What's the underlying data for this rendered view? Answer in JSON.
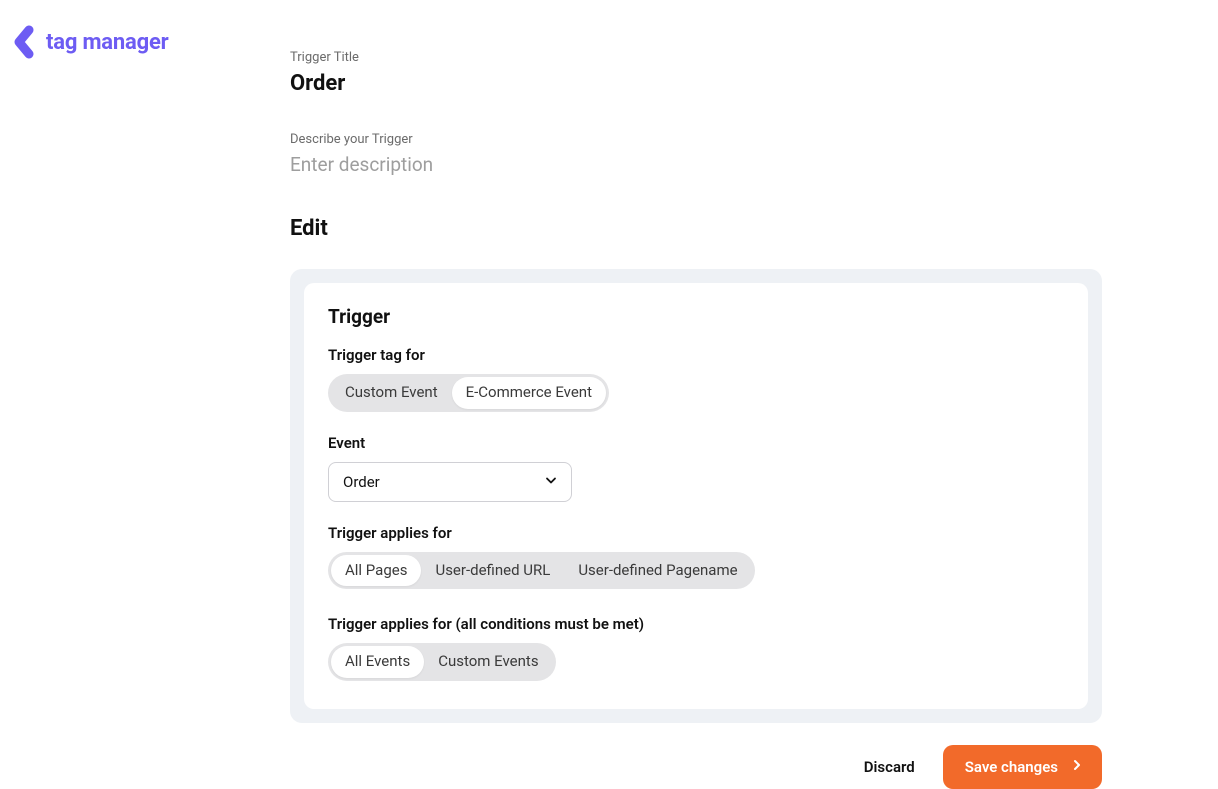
{
  "brand": {
    "name": "tag manager"
  },
  "header": {
    "trigger_title_label": "Trigger Title",
    "trigger_title_value": "Order",
    "describe_label": "Describe your Trigger",
    "describe_placeholder": "Enter description",
    "describe_value": ""
  },
  "edit": {
    "heading": "Edit",
    "panel_title": "Trigger",
    "trigger_tag_for": {
      "label": "Trigger tag for",
      "options": [
        "Custom Event",
        "E-Commerce Event"
      ],
      "selected_index": 1
    },
    "event": {
      "label": "Event",
      "selected": "Order"
    },
    "applies_for": {
      "label": "Trigger applies for",
      "options": [
        "All Pages",
        "User-defined URL",
        "User-defined Pagename"
      ],
      "selected_index": 0
    },
    "conditions": {
      "label": "Trigger applies for (all conditions must be met)",
      "options": [
        "All Events",
        "Custom Events"
      ],
      "selected_index": 0
    }
  },
  "actions": {
    "discard": "Discard",
    "save": "Save changes"
  }
}
